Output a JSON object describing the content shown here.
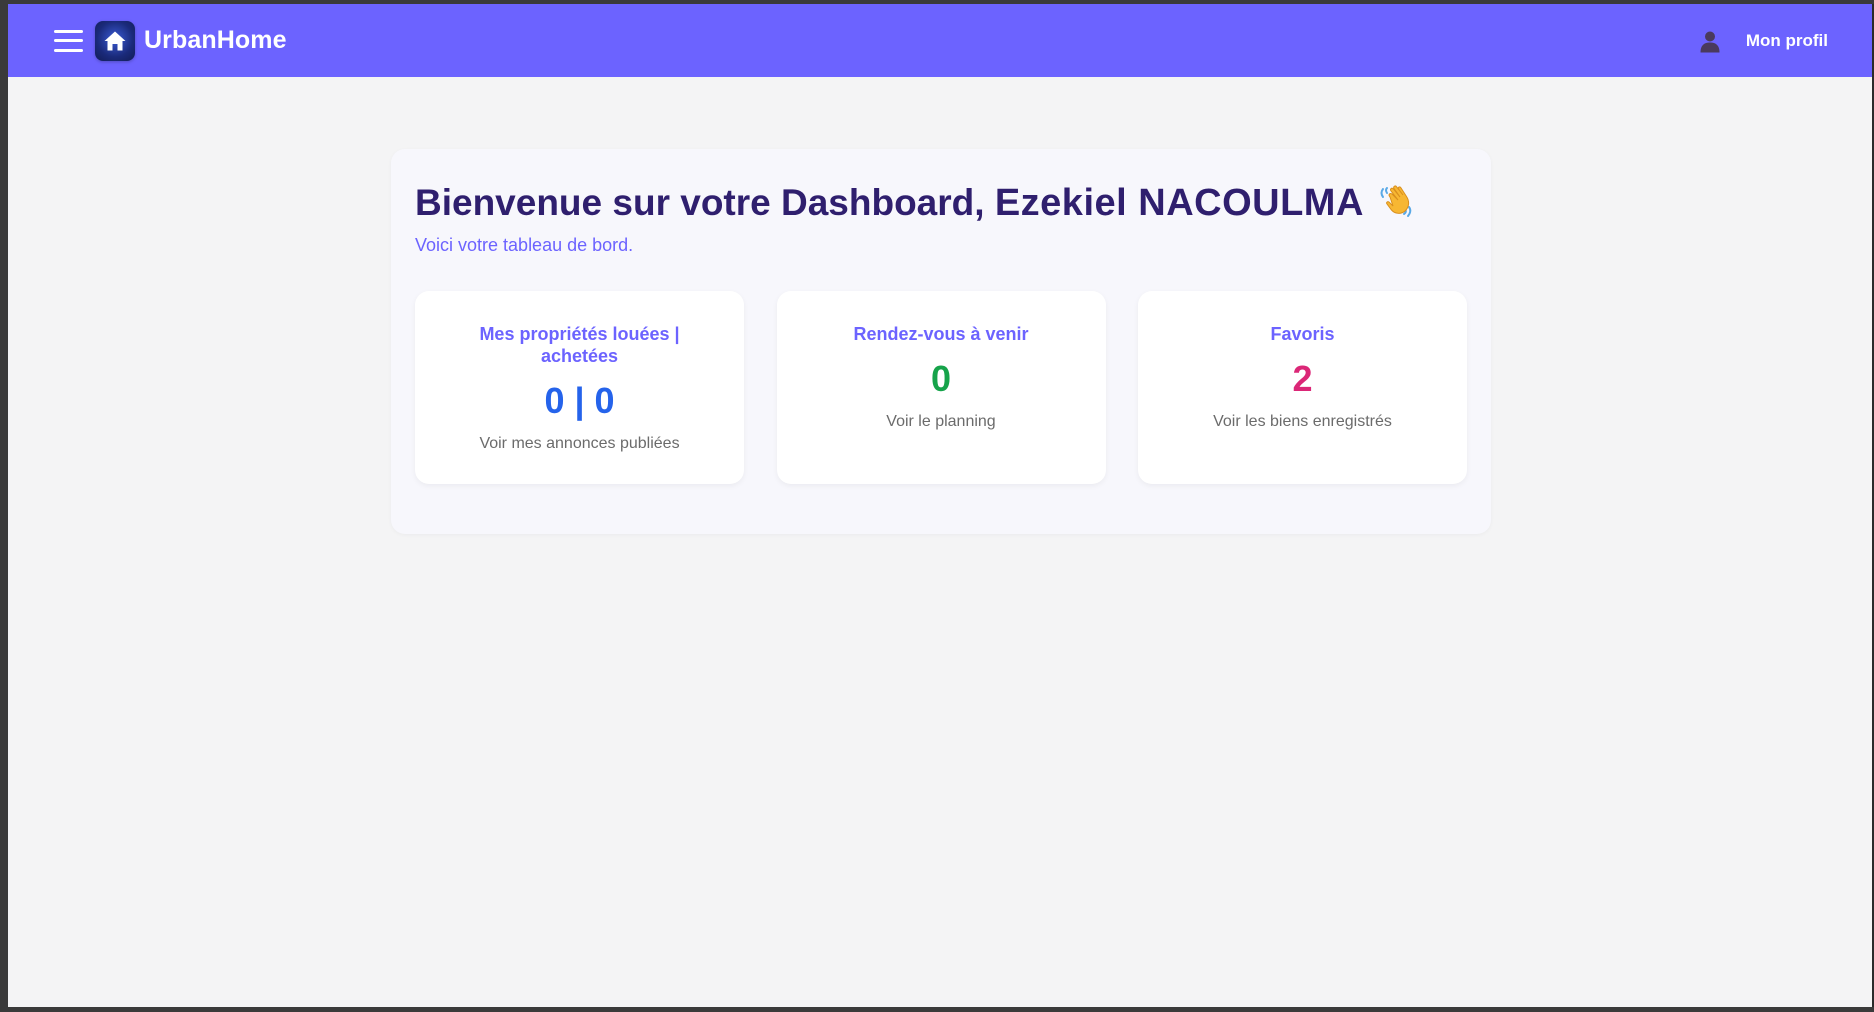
{
  "app": {
    "brand": "UrbanHome",
    "accent_color": "#6c63ff",
    "icons": {
      "menu": "hamburger-menu-icon",
      "logo": "home-icon",
      "profile": "user-icon",
      "greeting": "waving-hand-icon"
    }
  },
  "header": {
    "profile_label": "Mon profil"
  },
  "dashboard": {
    "title_prefix": "Bienvenue sur votre Dashboard, ",
    "username": "Ezekiel NACOULMA",
    "subtitle": "Voici votre tableau de bord.",
    "cards": [
      {
        "title": "Mes propriétés louées | achetées",
        "value": "0 | 0",
        "link": "Voir mes annonces publiées",
        "value_color": "#2563eb"
      },
      {
        "title": "Rendez-vous à venir",
        "value": "0",
        "link": "Voir le planning",
        "value_color": "#16a34a"
      },
      {
        "title": "Favoris",
        "value": "2",
        "link": "Voir les biens enregistrés",
        "value_color": "#db2777"
      }
    ]
  }
}
